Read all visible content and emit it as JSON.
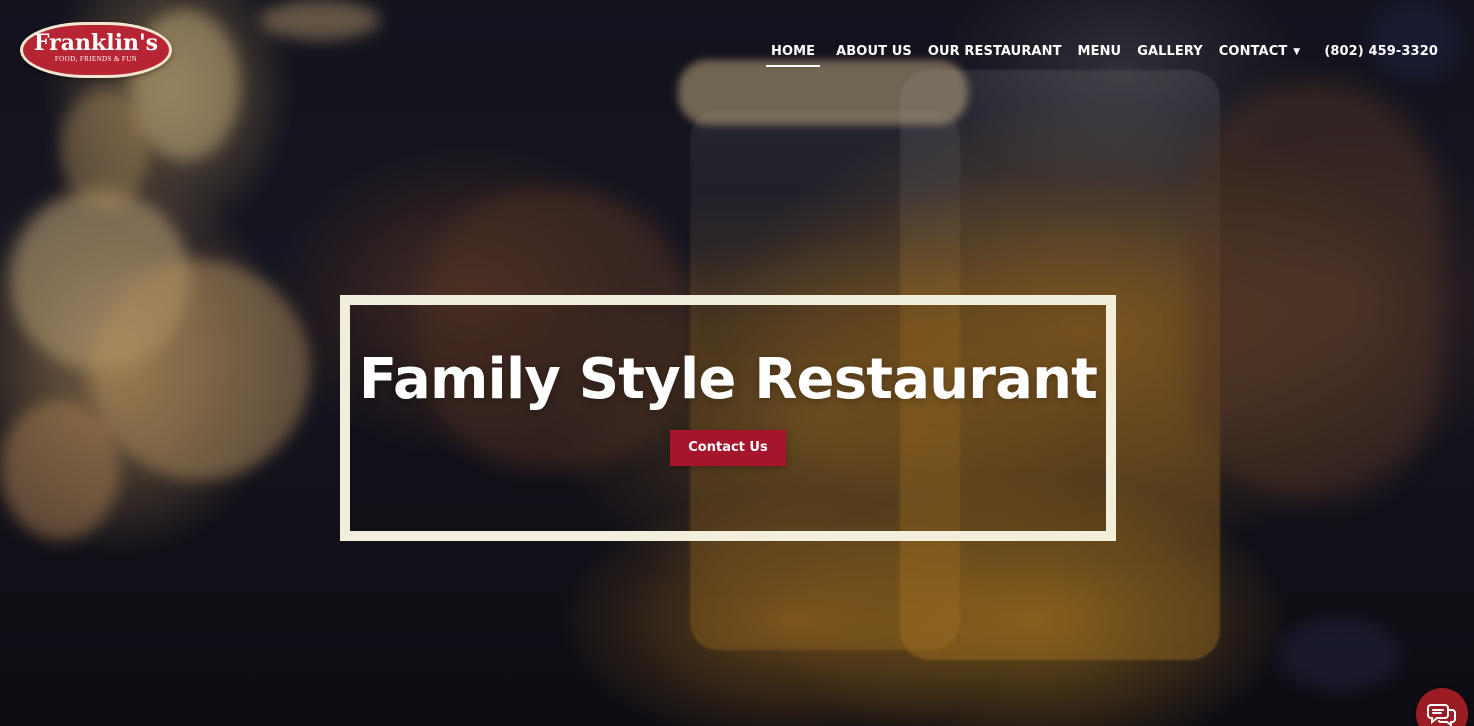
{
  "brand": {
    "name": "Franklin's",
    "tagline": "FOOD, FRIENDS & FUN"
  },
  "nav": {
    "items": [
      {
        "label": "HOME",
        "active": true
      },
      {
        "label": "ABOUT US",
        "active": false
      },
      {
        "label": "OUR RESTAURANT",
        "active": false
      },
      {
        "label": "MENU",
        "active": false
      },
      {
        "label": "GALLERY",
        "active": false
      },
      {
        "label": "CONTACT",
        "active": false
      }
    ],
    "phone": "(802) 459-3320",
    "contact_dropdown_icon": "chevron-down-icon"
  },
  "hero": {
    "title": "Family Style Restaurant",
    "cta_label": "Contact Us"
  },
  "chat": {
    "icon": "chat-bubbles-icon"
  },
  "colors": {
    "brand_red": "#b72534",
    "button_red": "#a5162d",
    "frame": "#f1efdb",
    "text": "#ffffff"
  }
}
